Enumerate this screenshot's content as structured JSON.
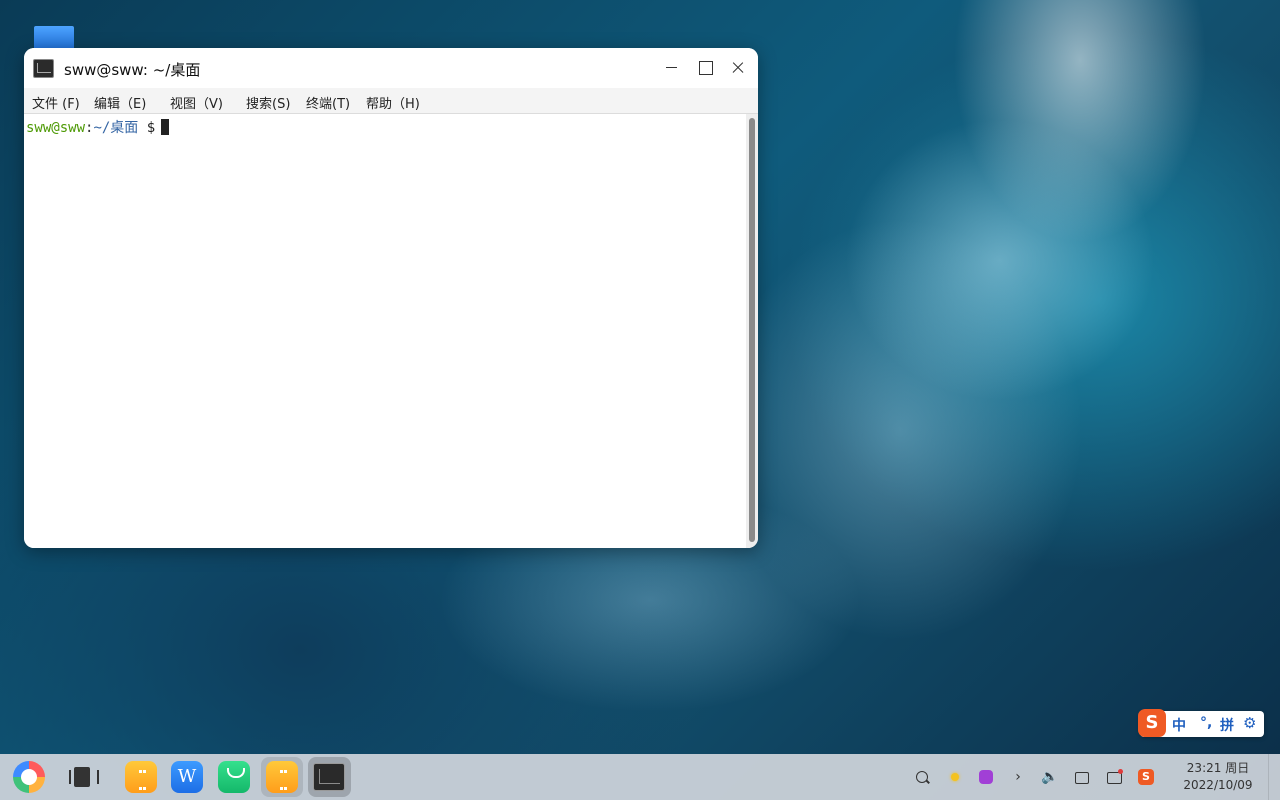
{
  "window": {
    "title": "sww@sww: ~/桌面"
  },
  "menu": [
    {
      "label": "文件 (F)"
    },
    {
      "label": "编辑（E)"
    },
    {
      "label": "视图（V)"
    },
    {
      "label": "搜索(S)"
    },
    {
      "label": "终端(T)"
    },
    {
      "label": "帮助（H)"
    }
  ],
  "terminal": {
    "user_host": "sww@sww",
    "colon": ":",
    "path": "~/桌面",
    "dollar": "$"
  },
  "ime": {
    "logo": "S",
    "lang": "中",
    "punct": "°,",
    "mode": "拼",
    "settings_icon": "gear-icon"
  },
  "taskbar": {
    "apps": [
      {
        "icon": "start-menu-icon"
      },
      {
        "icon": "multitask-view-icon"
      },
      {
        "icon": "file-manager-icon"
      },
      {
        "icon": "wps-writer-icon"
      },
      {
        "icon": "app-store-icon"
      },
      {
        "icon": "file-manager-icon"
      },
      {
        "icon": "terminal-icon"
      }
    ],
    "wps_glyph": "W",
    "tray": {
      "more_glyph": "›",
      "volume_glyph": "🔈"
    },
    "clock": {
      "time": "23:21 周日",
      "date": "2022/10/09"
    }
  },
  "colors": {
    "prompt_user": "#4e9a06",
    "prompt_path": "#3465a4",
    "ime_brand": "#ef5a24"
  }
}
